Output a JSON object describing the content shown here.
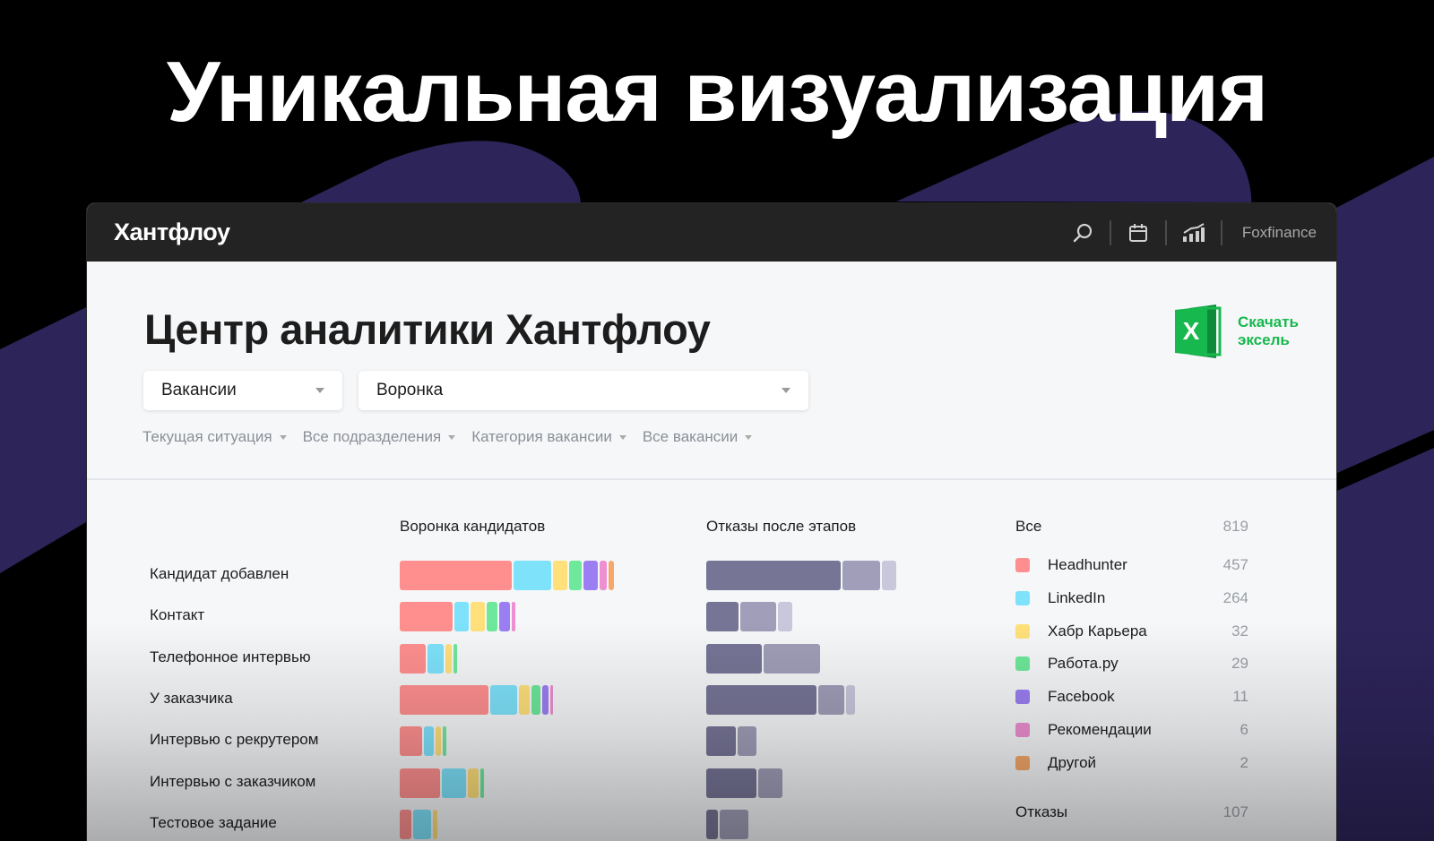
{
  "hero": {
    "title": "Уникальная визуализация"
  },
  "topbar": {
    "logo": "Хантфлоу",
    "icons": [
      "search-icon",
      "calendar-icon",
      "analytics-icon"
    ],
    "company": "Foxfinance"
  },
  "header": {
    "title": "Центр аналитики Хантфлоу",
    "excel_label": "Скачать эксель",
    "selects": [
      {
        "value": "Вакансии"
      },
      {
        "value": "Воронка"
      }
    ],
    "filters": [
      "Текущая ситуация",
      "Все подразделения",
      "Категория вакансии",
      "Все вакансии"
    ]
  },
  "columns": {
    "funnel": "Воронка кандидатов",
    "rejections": "Отказы после этапов"
  },
  "stages": [
    "Кандидат добавлен",
    "Контакт",
    "Телефонное интервью",
    "У заказчика",
    "Интервью с рекрутером",
    "Интервью с заказчиком",
    "Тестовое задание"
  ],
  "legend": {
    "all_label": "Все",
    "all_value": "819",
    "items": [
      {
        "name": "Headhunter",
        "value": "457",
        "color": "#ff8f8f"
      },
      {
        "name": "LinkedIn",
        "value": "264",
        "color": "#7ee2fb"
      },
      {
        "name": "Хабр Карьера",
        "value": "32",
        "color": "#ffe07a"
      },
      {
        "name": "Работа.ру",
        "value": "29",
        "color": "#6ee89a"
      },
      {
        "name": "Facebook",
        "value": "11",
        "color": "#9b7ff2"
      },
      {
        "name": "Рекомендации",
        "value": "6",
        "color": "#ee8fd1"
      },
      {
        "name": "Другой",
        "value": "2",
        "color": "#f5a86a"
      }
    ],
    "rejections_label": "Отказы",
    "rejections_value": "107"
  },
  "chart_data": {
    "type": "bar",
    "categories": [
      "Кандидат добавлен",
      "Контакт",
      "Телефонное интервью",
      "У заказчика",
      "Интервью с рекрутером",
      "Интервью с заказчиком",
      "Тестовое задание"
    ],
    "funnel_series": [
      [
        125,
        42,
        16,
        14,
        16,
        8,
        6
      ],
      [
        59,
        16,
        16,
        12,
        12,
        4
      ],
      [
        29,
        18,
        7,
        4
      ],
      [
        99,
        30,
        12,
        10,
        7,
        3
      ],
      [
        25,
        11,
        6,
        4
      ],
      [
        45,
        27,
        12,
        4
      ],
      [
        13,
        20,
        5
      ]
    ],
    "rejection_colors": [
      "#777596",
      "#a09eb8",
      "#c8c7dc"
    ],
    "rejection_series": [
      [
        150,
        42,
        16
      ],
      [
        36,
        40,
        16
      ],
      [
        62,
        63
      ],
      [
        123,
        29,
        10
      ],
      [
        33,
        21
      ],
      [
        56,
        27
      ],
      [
        13,
        32
      ]
    ]
  }
}
